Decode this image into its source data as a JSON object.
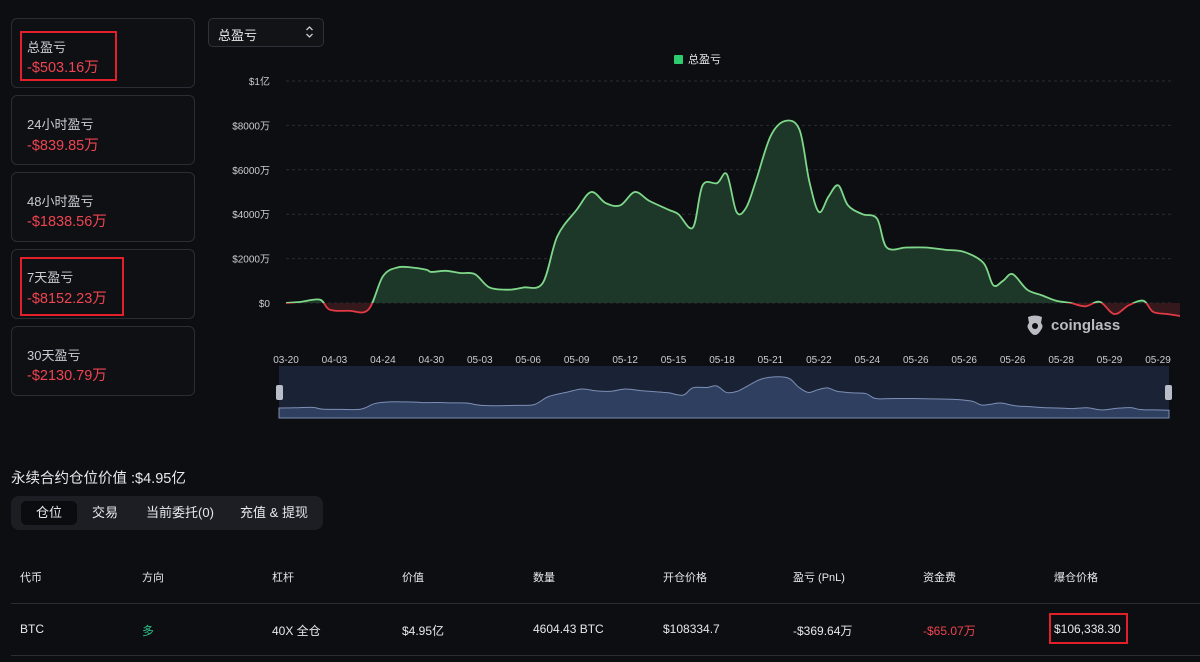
{
  "cards": [
    {
      "label": "总盈亏",
      "value": "-$503.16万"
    },
    {
      "label": "24小时盈亏",
      "value": "-$839.85万"
    },
    {
      "label": "48小时盈亏",
      "value": "-$1838.56万"
    },
    {
      "label": "7天盈亏",
      "value": "-$8152.23万"
    },
    {
      "label": "30天盈亏",
      "value": "-$2130.79万"
    }
  ],
  "select": {
    "value": "总盈亏"
  },
  "chart_data": {
    "type": "area",
    "legend": [
      "总盈亏"
    ],
    "legend_position": "top-center",
    "y_ticks": [
      "$1亿",
      "$8000万",
      "$6000万",
      "$4000万",
      "$2000万",
      "$0"
    ],
    "ylim": [
      -600,
      10000
    ],
    "y_unit": "万",
    "x_ticks": [
      "03-20",
      "04-03",
      "04-24",
      "04-30",
      "05-03",
      "05-06",
      "05-09",
      "05-12",
      "05-15",
      "05-18",
      "05-21",
      "05-22",
      "05-24",
      "05-26",
      "05-26",
      "05-26",
      "05-28",
      "05-29",
      "05-29"
    ],
    "grid": true,
    "colors": {
      "positive": "#7fd88a",
      "negative": "#e23a45",
      "fill": "#1f3a2a"
    },
    "points": [
      [
        0,
        0
      ],
      [
        0.3,
        50
      ],
      [
        0.7,
        150
      ],
      [
        0.9,
        -300
      ],
      [
        1.3,
        -350
      ],
      [
        1.7,
        -300
      ],
      [
        2.0,
        1200
      ],
      [
        2.3,
        1600
      ],
      [
        2.6,
        1600
      ],
      [
        2.9,
        1500
      ],
      [
        3.0,
        1400
      ],
      [
        3.3,
        1450
      ],
      [
        3.6,
        1350
      ],
      [
        3.9,
        1300
      ],
      [
        4.2,
        700
      ],
      [
        4.6,
        600
      ],
      [
        4.9,
        700
      ],
      [
        5.3,
        900
      ],
      [
        5.6,
        3000
      ],
      [
        6.0,
        4200
      ],
      [
        6.3,
        5000
      ],
      [
        6.6,
        4500
      ],
      [
        6.9,
        4400
      ],
      [
        7.2,
        5000
      ],
      [
        7.5,
        4600
      ],
      [
        7.9,
        4200
      ],
      [
        8.1,
        4000
      ],
      [
        8.4,
        3400
      ],
      [
        8.6,
        5300
      ],
      [
        8.9,
        5400
      ],
      [
        9.1,
        5800
      ],
      [
        9.3,
        4100
      ],
      [
        9.5,
        4300
      ],
      [
        9.7,
        5500
      ],
      [
        10.0,
        7500
      ],
      [
        10.3,
        8200
      ],
      [
        10.6,
        7800
      ],
      [
        10.8,
        5500
      ],
      [
        11.0,
        4100
      ],
      [
        11.2,
        4800
      ],
      [
        11.4,
        5300
      ],
      [
        11.6,
        4400
      ],
      [
        11.9,
        4000
      ],
      [
        12.2,
        3800
      ],
      [
        12.4,
        2500
      ],
      [
        12.8,
        2500
      ],
      [
        13.2,
        2500
      ],
      [
        13.6,
        2400
      ],
      [
        14.0,
        2300
      ],
      [
        14.4,
        1800
      ],
      [
        14.6,
        800
      ],
      [
        14.8,
        1000
      ],
      [
        15.0,
        1300
      ],
      [
        15.3,
        600
      ],
      [
        15.6,
        350
      ],
      [
        15.9,
        100
      ],
      [
        16.2,
        0
      ],
      [
        16.5,
        -150
      ],
      [
        16.8,
        50
      ],
      [
        17.1,
        -500
      ],
      [
        17.4,
        -100
      ],
      [
        17.7,
        100
      ],
      [
        17.9,
        -400
      ],
      [
        18.2,
        -500
      ],
      [
        18.5,
        -600
      ]
    ]
  },
  "position_title": "永续合约仓位价值 :$4.95亿",
  "tabs": [
    "仓位",
    "交易",
    "当前委托(0)",
    "充值 & 提现"
  ],
  "table": {
    "headers": [
      "代币",
      "方向",
      "杠杆",
      "价值",
      "数量",
      "开仓价格",
      "盈亏 (PnL)",
      "资金费",
      "爆仓价格"
    ],
    "row": [
      "BTC",
      "多",
      "40X 全仓",
      "$4.95亿",
      "4604.43 BTC",
      "$108334.7",
      "-$369.64万",
      "-$65.07万",
      "$106,338.30"
    ]
  },
  "logo_text": "coinglass"
}
